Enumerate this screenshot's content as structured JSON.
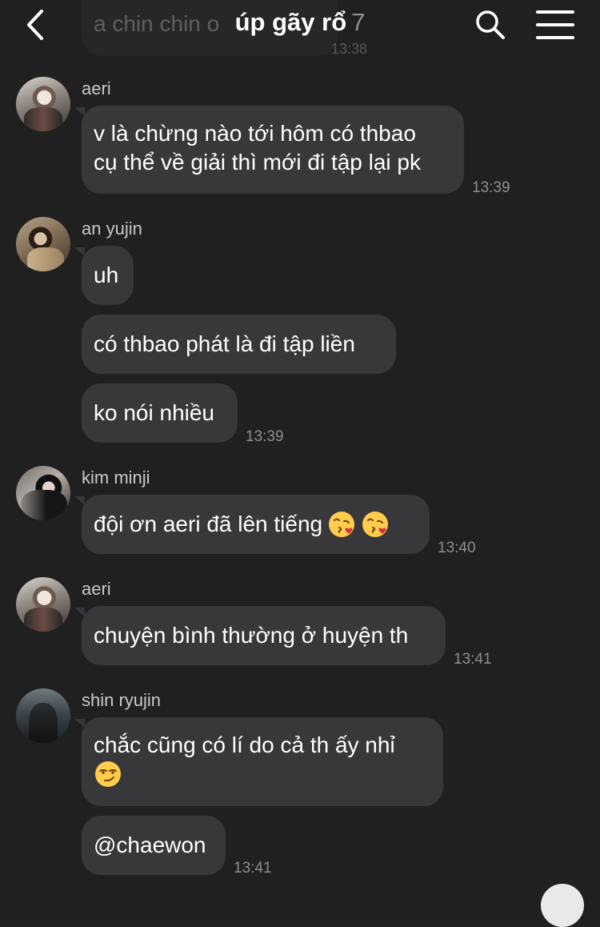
{
  "header": {
    "title": "úp gãy rổ",
    "member_count": "7",
    "pinned_preview_text": "a chin chin o",
    "pinned_preview_time": "13:38"
  },
  "messages": [
    {
      "sender": "aeri",
      "bubbles": [
        {
          "lines": [
            "v là chừng nào tới hôm có thbao",
            "cụ thể về giải thì mới đi tập lại pk"
          ]
        }
      ],
      "time": "13:39"
    },
    {
      "sender": "an yujin",
      "bubbles": [
        {
          "text": "uh"
        },
        {
          "text": "có thbao phát là đi tập liền"
        },
        {
          "text": "ko nói nhiều"
        }
      ],
      "time": "13:39"
    },
    {
      "sender": "kim minji",
      "bubbles": [
        {
          "text": "đội ơn aeri đã lên tiếng",
          "emojis": [
            "kissing-heart",
            "kissing-heart"
          ]
        }
      ],
      "time": "13:40"
    },
    {
      "sender": "aeri",
      "bubbles": [
        {
          "text": "chuyện bình thường ở huyện th"
        }
      ],
      "time": "13:41"
    },
    {
      "sender": "shin ryujin",
      "bubbles": [
        {
          "text": "chắc cũng có lí do cả th ấy nhỉ",
          "emoji_line": "smirk"
        },
        {
          "text": "@chaewon"
        }
      ],
      "time": "13:41"
    }
  ],
  "icons": {
    "back": "chevron-left-icon",
    "search": "search-icon",
    "menu": "hamburger-menu-icon"
  },
  "colors": {
    "background": "#202021",
    "bubble": "#38383a",
    "text": "#ffffff",
    "secondary_text": "#8e8e92",
    "sender_name": "#c9c9cc"
  }
}
